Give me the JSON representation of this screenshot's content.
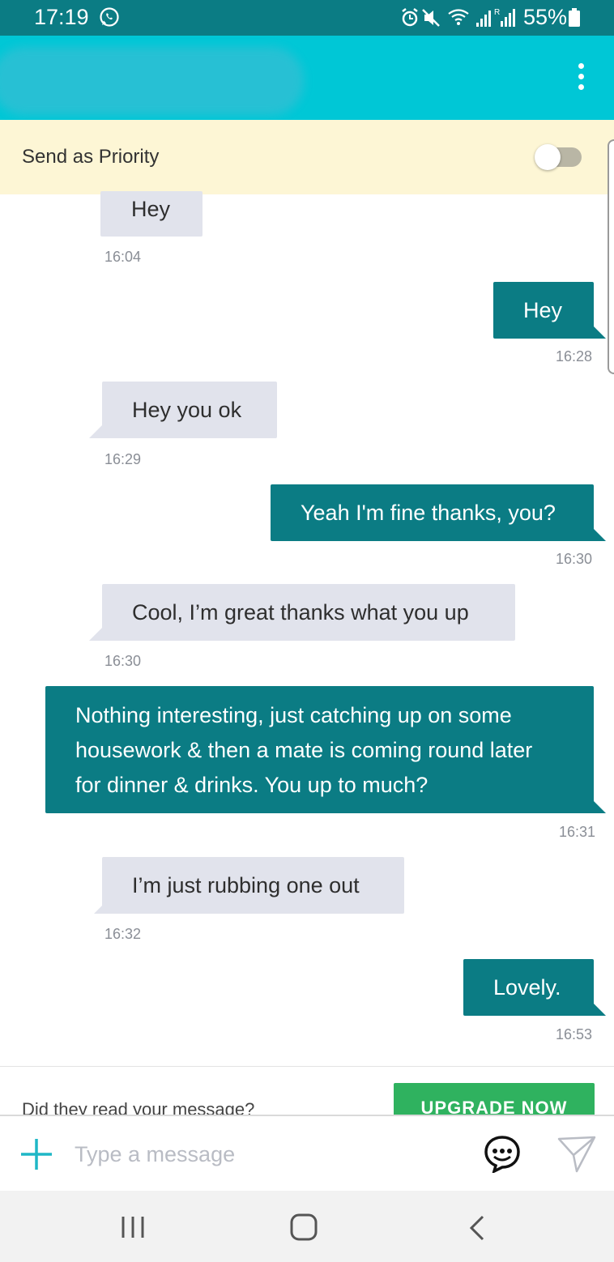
{
  "status_bar": {
    "time": "17:19",
    "battery": "55%",
    "icons": [
      "whatsapp-icon",
      "alarm-icon",
      "mute-icon",
      "wifi-icon",
      "signal-icon",
      "signal-roaming-icon",
      "battery-icon"
    ]
  },
  "app_bar": {
    "menu_icon": "more-vertical-icon",
    "accent": "#00c7d6"
  },
  "priority": {
    "label": "Send as Priority",
    "enabled": false
  },
  "messages": [
    {
      "direction": "incoming",
      "text": "Hey",
      "time": "16:04"
    },
    {
      "direction": "outgoing",
      "text": "Hey",
      "time": "16:28"
    },
    {
      "direction": "incoming",
      "text": "Hey you ok",
      "time": "16:29"
    },
    {
      "direction": "outgoing",
      "text": "Yeah I'm fine thanks, you?",
      "time": "16:30"
    },
    {
      "direction": "incoming",
      "text": "Cool, I’m great thanks what you up",
      "time": "16:30"
    },
    {
      "direction": "outgoing",
      "text_lines": [
        "Nothing interesting, just catching up on some",
        "housework & then a mate is coming round later",
        "for dinner & drinks. You up to much?"
      ],
      "time": "16:31"
    },
    {
      "direction": "incoming",
      "text": "I’m just rubbing one out",
      "time": "16:32"
    },
    {
      "direction": "outgoing",
      "text": "Lovely.",
      "time": "16:53"
    }
  ],
  "upsell": {
    "text": "Did they read your message?",
    "button": "UPGRADE NOW",
    "button_color": "#2fb25f"
  },
  "composer": {
    "placeholder": "Type a message",
    "icons": [
      "plus-icon",
      "emoji-chat-icon",
      "send-icon"
    ]
  },
  "colors": {
    "outgoing_bubble": "#0b7c84",
    "incoming_bubble": "#e1e3ec",
    "priority_bg": "#fdf6d5"
  }
}
